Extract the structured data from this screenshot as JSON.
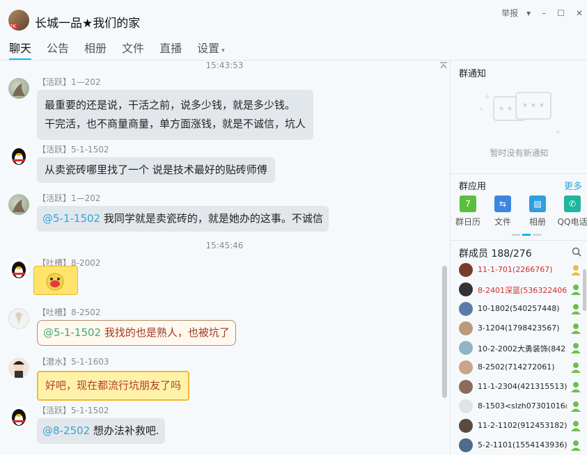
{
  "window": {
    "group_name": "长城一品★我们的家",
    "avatar_tag": "2K",
    "report_label": "举报",
    "controls": [
      "▾",
      "–",
      "☐",
      "✕"
    ]
  },
  "tabs": [
    {
      "label": "聊天",
      "active": true
    },
    {
      "label": "公告",
      "active": false
    },
    {
      "label": "相册",
      "active": false
    },
    {
      "label": "文件",
      "active": false
    },
    {
      "label": "直播",
      "active": false
    },
    {
      "label": "设置",
      "active": false,
      "caret": "▾"
    }
  ],
  "chat": {
    "timestamps": [
      "15:43:53",
      "15:45:46"
    ],
    "messages": [
      {
        "sender": "【活跃】1—202",
        "lines": [
          "最重要的还是说，干活之前，说多少钱，就是多少钱。",
          "干完活，也不商量商量，单方面涨钱，就是不诚信，坑人"
        ]
      },
      {
        "sender": "【活跃】5-1-1502",
        "text": "从卖瓷砖哪里找了一个 说是技术最好的贴砖师傅"
      },
      {
        "sender": "【活跃】1—202",
        "mention": "@5-1-1502",
        "text": " 我同学就是卖瓷砖的，就是她办的这事。不诚信"
      },
      {
        "sender": "【吐槽】8-2002",
        "sticker": "sticker-emoji"
      },
      {
        "sender": "【吐槽】8-2502",
        "mention": "@5-1-1502",
        "text": " 我找的也是熟人，也被坑了"
      },
      {
        "sender": "【潜水】5-1-1603",
        "text": "好吧，现在都流行坑朋友了吗"
      },
      {
        "sender": "【活跃】5-1-1502",
        "mention": "@8-2502",
        "text": " 想办法补救吧."
      }
    ]
  },
  "side": {
    "notice_title": "群通知",
    "notice_empty": "暂时没有新通知",
    "apps_title": "群应用",
    "more_label": "更多",
    "apps": [
      {
        "label": "群日历",
        "color": "#5bbf3a",
        "glyph": "7"
      },
      {
        "label": "文件",
        "color": "#3d86e0",
        "glyph": "⇆"
      },
      {
        "label": "相册",
        "color": "#2f9fe0",
        "glyph": "▨"
      },
      {
        "label": "QQ电话",
        "color": "#1fb5a0",
        "glyph": "✆"
      }
    ],
    "members_title": "群成员 188/276",
    "members": [
      {
        "name": "11-1-701(2266767)",
        "red": true,
        "role_color": "#f0b93a"
      },
      {
        "name": "8-2401深蓝(536322406)",
        "red": true,
        "role_color": "#6cc04a"
      },
      {
        "name": "10-1802(540257448)",
        "red": false,
        "role_color": "#6cc04a"
      },
      {
        "name": "3-1204(1798423567)",
        "red": false,
        "role_color": "#6cc04a"
      },
      {
        "name": "10-2-2002大勇装饰(842",
        "red": false,
        "role_color": "#6cc04a"
      },
      {
        "name": "8-2502(714272061)",
        "red": false,
        "role_color": "#6cc04a"
      },
      {
        "name": "11-1-2304(421315513)",
        "red": false,
        "role_color": "#6cc04a"
      },
      {
        "name": "8-1503<slzh07301016@",
        "red": false,
        "role_color": "#6cc04a"
      },
      {
        "name": "11-2-1102(912453182)",
        "red": false,
        "role_color": "#6cc04a"
      },
      {
        "name": "5-2-1101(1554143936)",
        "red": false,
        "role_color": "#6cc04a"
      }
    ]
  }
}
